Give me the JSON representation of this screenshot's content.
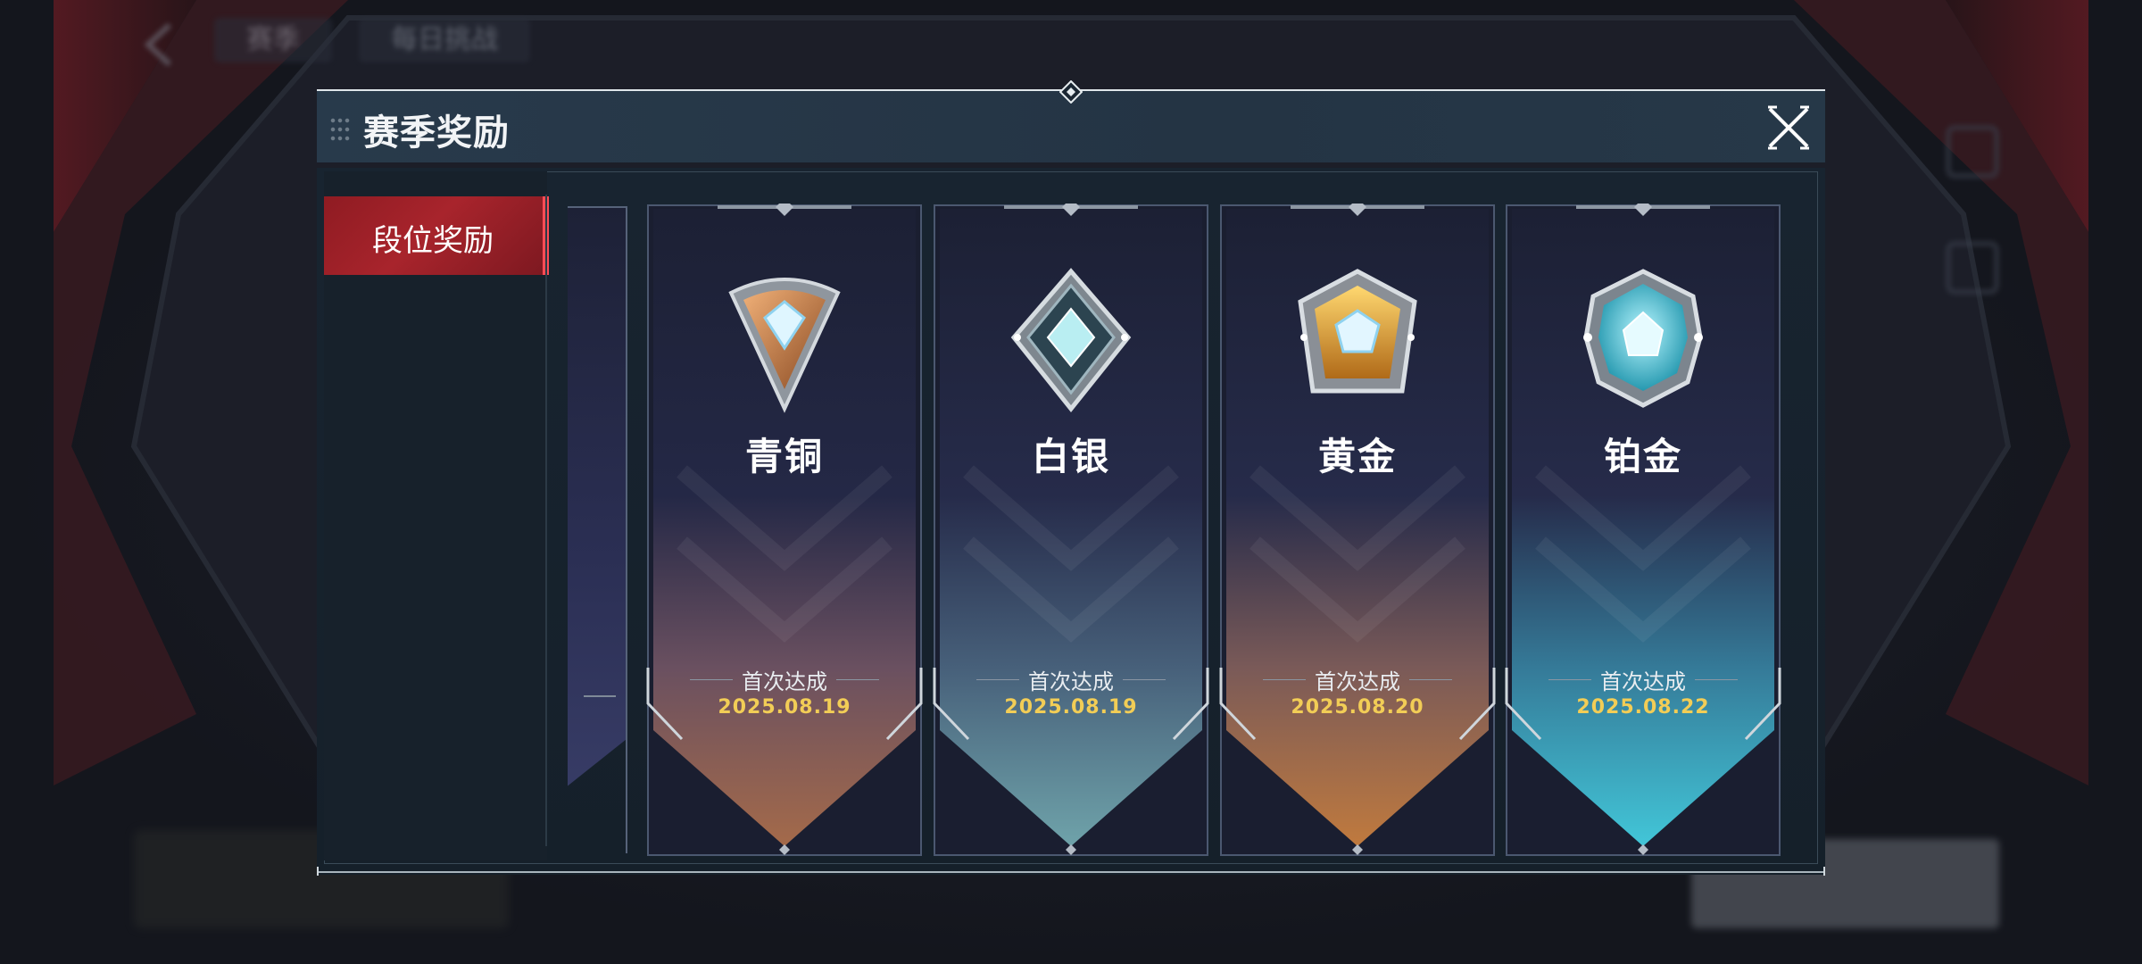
{
  "background": {
    "top_tabs": [
      "赛季",
      "每日挑战"
    ]
  },
  "modal": {
    "title": "赛季奖励",
    "close_icon": "close-x-icon"
  },
  "sidebar": {
    "tabs": [
      {
        "label": "段位奖励",
        "selected": true
      }
    ]
  },
  "ranks": [
    {
      "name": "青铜",
      "achieved_label": "首次达成",
      "date": "2025.08.19",
      "theme": "bronze",
      "accent": "#c08040"
    },
    {
      "name": "白银",
      "achieved_label": "首次达成",
      "date": "2025.08.19",
      "theme": "silver",
      "accent": "#7fb6bd"
    },
    {
      "name": "黄金",
      "achieved_label": "首次达成",
      "date": "2025.08.20",
      "theme": "gold",
      "accent": "#d69a3c"
    },
    {
      "name": "铂金",
      "achieved_label": "首次达成",
      "date": "2025.08.22",
      "theme": "platinum",
      "accent": "#3fc6d8"
    }
  ],
  "colors": {
    "date_text": "#f2cd56",
    "selected_tab": "#a8242c",
    "header_bg": "#263848"
  }
}
